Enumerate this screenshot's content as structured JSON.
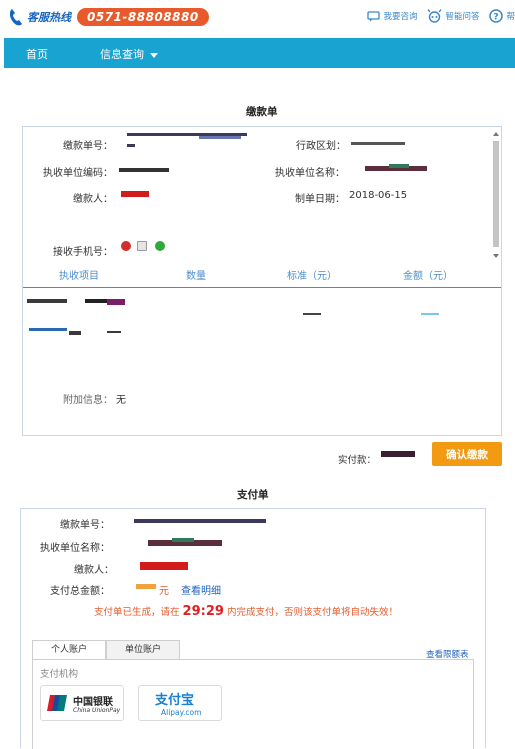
{
  "header": {
    "hotline_label": "客服热线",
    "hotline_number": "0571-88808880",
    "links": [
      {
        "label": "我要咨询",
        "icon": "chat-icon"
      },
      {
        "label": "智能问答",
        "icon": "robot-icon"
      },
      {
        "label": "帮",
        "icon": "help-icon"
      }
    ]
  },
  "nav": {
    "home": "首页",
    "query": "信息查询"
  },
  "notice": {
    "title": "缴款单",
    "fields": {
      "bill_no_label": "缴款单号：",
      "district_label": "行政区划：",
      "unit_code_label": "执收单位编码：",
      "unit_name_label": "执收单位名称：",
      "payer_label": "缴款人：",
      "date_label": "制单日期：",
      "date_value": "2018-06-15",
      "phone_label": "接收手机号："
    },
    "table_headers": [
      "执收项目",
      "数量",
      "标准（元）",
      "金额（元）"
    ],
    "extra_label": "附加信息：",
    "extra_value": "无"
  },
  "pay_bar": {
    "actual_label": "实付款：",
    "confirm_label": "确认缴款"
  },
  "slip": {
    "title": "支付单",
    "bill_no_label": "缴款单号：",
    "unit_name_label": "执收单位名称：",
    "payer_label": "缴款人：",
    "total_label": "支付总金额：",
    "total_unit": "元",
    "detail_link": "查看明细",
    "countdown_prefix": "支付单已生成，请在",
    "countdown": "29:29",
    "countdown_suffix": "内完成支付，否则该支付单将自动失效！",
    "tabs": [
      "个人账户",
      "单位账户"
    ],
    "limit_link": "查看限额表",
    "pay_org_label": "支付机构",
    "banks": [
      {
        "name_cn": "中国银联",
        "name_en": "China UnionPay"
      },
      {
        "name_cn": "支付宝",
        "name_en": "Alipay.com"
      }
    ]
  },
  "colors": {
    "nav": "#19a3d1",
    "accent": "#f39a13",
    "hotline": "#e8592b",
    "link": "#3a87c8"
  }
}
